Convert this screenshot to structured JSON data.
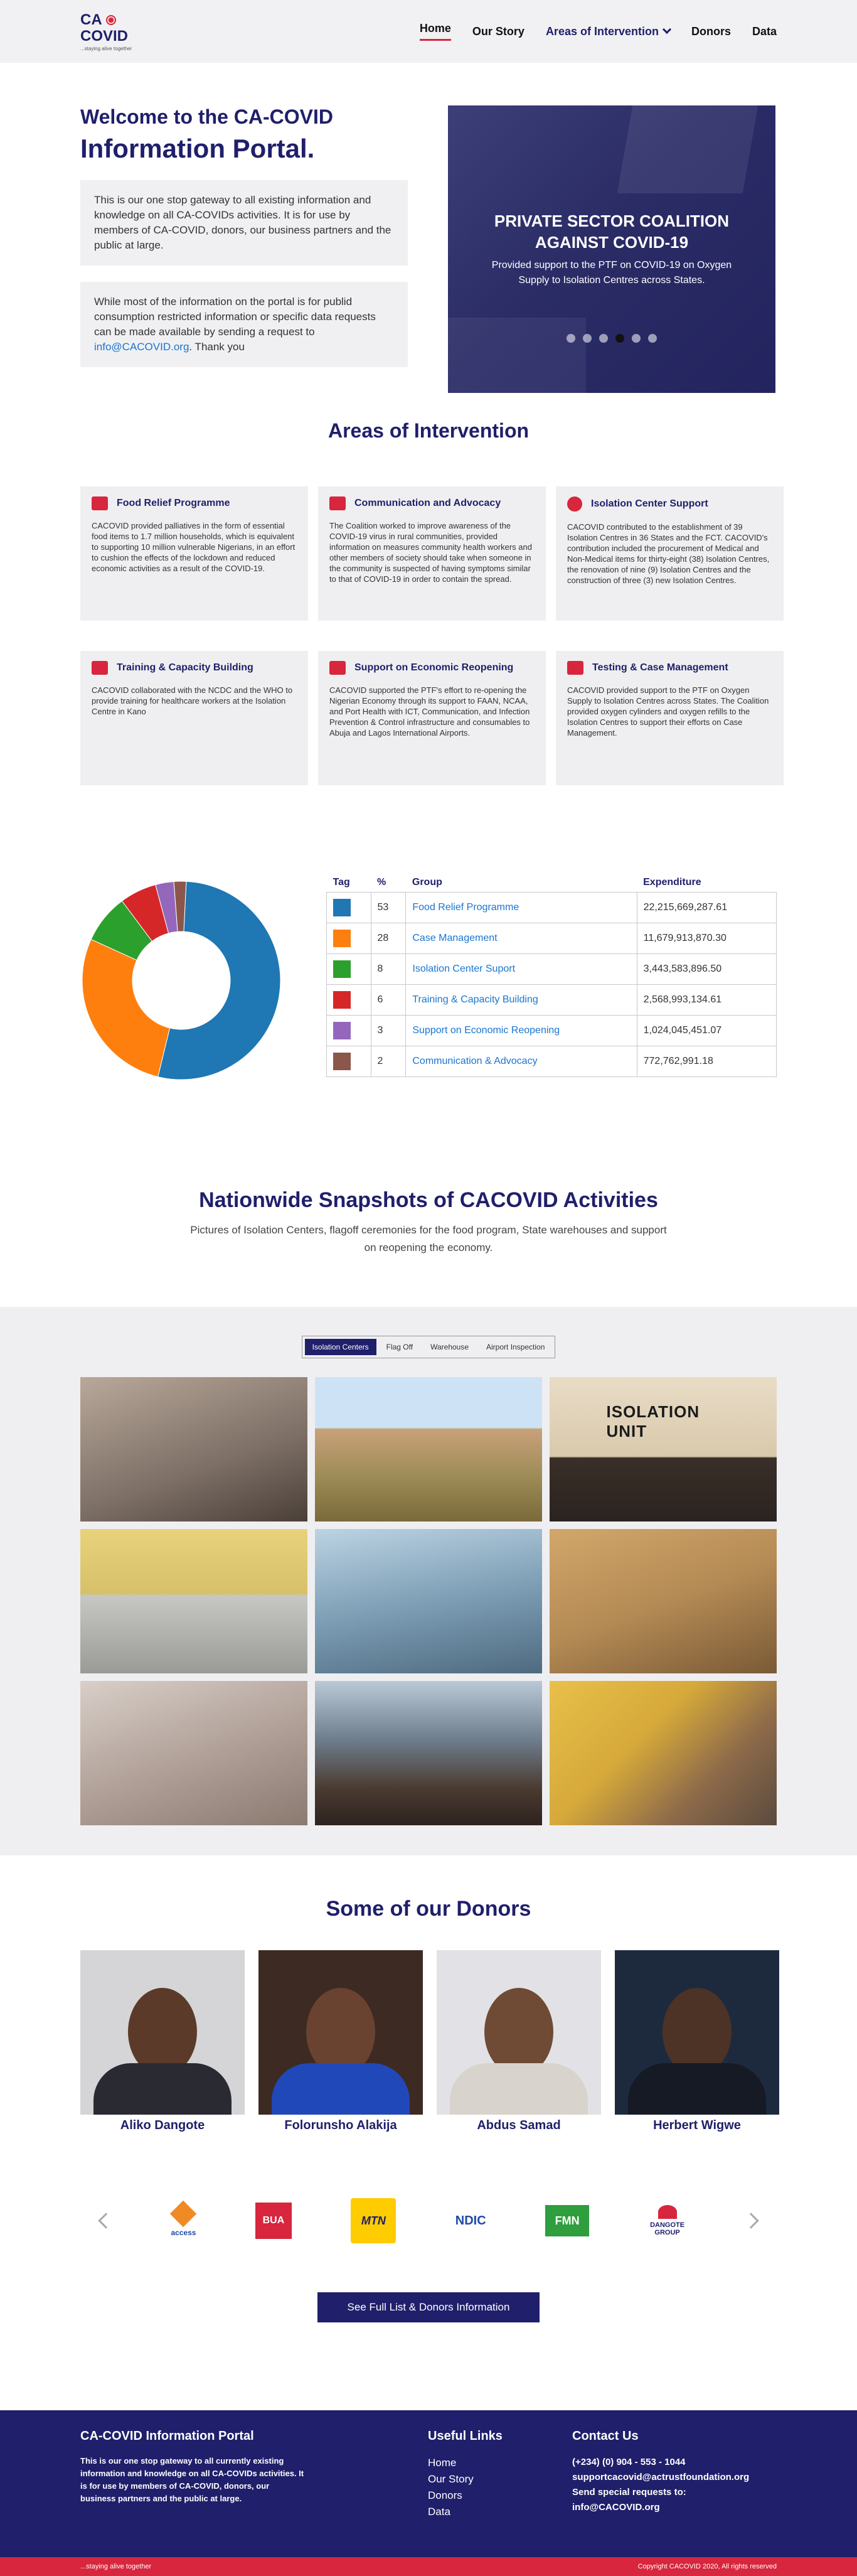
{
  "header": {
    "logo_line1": "CA",
    "logo_line2": "COVID",
    "logo_tag": "...staying alive together",
    "nav": [
      "Home",
      "Our Story",
      "Areas of Intervention",
      "Donors",
      "Data"
    ]
  },
  "hero": {
    "title_line1": "Welcome to the CA-COVID",
    "title_line2": "Information Portal.",
    "para1": "This is our one stop gateway to all existing information and knowledge on all CA-COVIDs activities. It is for use by members of CA-COVID, donors, our business partners and the public at large.",
    "para2_prefix": "While most of the information on the portal is for publid consumption restricted information or specific data requests can be made available by sending a request to ",
    "para2_email": "info@CACOVID.org",
    "para2_suffix": ". Thank you",
    "slide_title": "PRIVATE SECTOR COALITION AGAINST COVID-19",
    "slide_desc": "Provided support to the PTF on COVID-19 on Oxygen Supply to Isolation Centres across States."
  },
  "areas": {
    "title": "Areas of Intervention",
    "cards": [
      {
        "title": "Food Relief Programme",
        "body": "CACOVID provided palliatives in the form of essential food items to 1.7 million households, which is equivalent to supporting 10 million vulnerable Nigerians, in an effort to cushion the effects of the lockdown and reduced economic activities as a result of the COVID-19."
      },
      {
        "title": "Communication and Advocacy",
        "body": "The Coalition worked to improve awareness of the COVID-19 virus in rural communities, provided information on measures community health workers and other members of society should take when someone in the community is suspected of having symptoms similar to that of COVID-19 in order to contain the spread."
      },
      {
        "title": "Isolation Center Support",
        "body": "CACOVID contributed to the establishment of 39 Isolation Centres in 36 States and the FCT. CACOVID's contribution included the procurement of Medical and Non-Medical items for thirty-eight (38) Isolation Centres, the renovation of nine (9) Isolation Centres and the construction of three (3) new Isolation Centres."
      },
      {
        "title": "Training & Capacity Building",
        "body": "CACOVID collaborated with the NCDC and the WHO to provide training for healthcare workers at the Isolation Centre in Kano"
      },
      {
        "title": "Support on Economic Reopening",
        "body": "CACOVID supported the PTF's effort to re-opening the Nigerian Economy through its support to FAAN, NCAA, and Port Health with ICT, Communication, and Infection Prevention & Control infrastructure and consumables to Abuja and Lagos International Airports."
      },
      {
        "title": "Testing & Case Management",
        "body": "CACOVID provided support to the PTF on Oxygen Supply to Isolation Centres across States. The Coalition provided oxygen cylinders and oxygen refills to the Isolation Centres to support their efforts on Case Management."
      }
    ]
  },
  "table": {
    "headers": [
      "Tag",
      "%",
      "Group",
      "Expenditure"
    ],
    "rows": [
      {
        "pct": "53",
        "group": "Food Relief Programme",
        "exp": "22,215,669,287.61"
      },
      {
        "pct": "28",
        "group": "Case Management",
        "exp": "11,679,913,870.30"
      },
      {
        "pct": "8",
        "group": "Isolation Center Suport",
        "exp": "3,443,583,896.50"
      },
      {
        "pct": "6",
        "group": "Training & Capacity Building",
        "exp": "2,568,993,134.61"
      },
      {
        "pct": "3",
        "group": "Support on Economic Reopening",
        "exp": "1,024,045,451.07"
      },
      {
        "pct": "2",
        "group": "Communication & Advocacy",
        "exp": "772,762,991.18"
      }
    ]
  },
  "chart_data": {
    "type": "pie",
    "categories": [
      "Food Relief Programme",
      "Case Management",
      "Isolation Center Suport",
      "Training & Capacity Building",
      "Support on Economic Reopening",
      "Communication & Advocacy"
    ],
    "values": [
      53,
      28,
      8,
      6,
      3,
      2
    ],
    "colors": [
      "#1f77b4",
      "#ff7f0e",
      "#2ca02c",
      "#d62728",
      "#9467bd",
      "#8c564b"
    ]
  },
  "snapshots": {
    "title": "Nationwide Snapshots of CACOVID Activities",
    "subtitle": "Pictures of Isolation Centers, flagoff ceremonies for the food program, State warehouses and support on reopening the economy.",
    "tabs": [
      "Isolation Centers",
      "Flag Off",
      "Warehouse",
      "Airport Inspection"
    ],
    "photo_caption": "ISOLATION UNIT"
  },
  "donors": {
    "title": "Some of our Donors",
    "people": [
      "Aliko Dangote",
      "Folorunsho Alakija",
      "Abdus Samad",
      "Herbert Wigwe"
    ],
    "logos": [
      "access",
      "BUA",
      "MTN",
      "NDIC",
      "FMN",
      "DANGOTE GROUP"
    ],
    "cta": "See Full List & Donors Information"
  },
  "footer": {
    "col1_title": "CA-COVID Information Portal",
    "col1_text": "This is our one stop gateway to all currently existing information and knowledge on all CA-COVIDs activities. It is for use by members of CA-COVID, donors, our business partners and the public at large.",
    "col2_title": "Useful Links",
    "links": [
      "Home",
      "Our Story",
      "Donors",
      "Data"
    ],
    "col3_title": "Contact Us",
    "phone": "(+234) (0) 904 - 553 - 1044",
    "email": "supportcacovid@actrustfoundation.org",
    "special_label": "Send special requests to:",
    "special_email": "info@CACOVID.org",
    "tagline": "...staying alive together",
    "copyright": "Copyright CACOVID 2020, All rights reserved"
  }
}
